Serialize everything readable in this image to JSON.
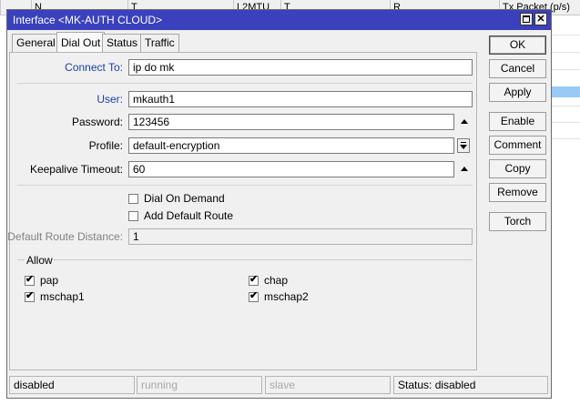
{
  "background": {
    "columns": [
      {
        "text": "N"
      },
      {
        "text": "T"
      },
      {
        "text": "L2MTU"
      },
      {
        "text": "T"
      },
      {
        "text": "R"
      },
      {
        "text": "Tx Packet (p/s)"
      }
    ]
  },
  "window": {
    "title": "Interface <MK-AUTH CLOUD>",
    "maximize_label": "",
    "close_label": "✕"
  },
  "tabs": [
    {
      "label": "General"
    },
    {
      "label": "Dial Out"
    },
    {
      "label": "Status"
    },
    {
      "label": "Traffic"
    }
  ],
  "form": {
    "connect_to": {
      "label": "Connect To:",
      "value": "ip do mk"
    },
    "user": {
      "label": "User:",
      "value": "mkauth1"
    },
    "password": {
      "label": "Password:",
      "value": "123456"
    },
    "profile": {
      "label": "Profile:",
      "value": "default-encryption"
    },
    "keepalive": {
      "label": "Keepalive Timeout:",
      "value": "60"
    },
    "dial_on_demand": {
      "label": "Dial On Demand",
      "checked": false
    },
    "add_default_route": {
      "label": "Add Default Route",
      "checked": false
    },
    "default_route_distance": {
      "label": "Default Route Distance:",
      "value": "1"
    }
  },
  "allow": {
    "legend": "Allow",
    "items": [
      {
        "label": "pap",
        "checked": true
      },
      {
        "label": "chap",
        "checked": true
      },
      {
        "label": "mschap1",
        "checked": true
      },
      {
        "label": "mschap2",
        "checked": true
      }
    ],
    "check_glyph": "✔"
  },
  "buttons": [
    {
      "label": "OK"
    },
    {
      "label": "Cancel"
    },
    {
      "label": "Apply"
    },
    {
      "label": "Enable"
    },
    {
      "label": "Comment"
    },
    {
      "label": "Copy"
    },
    {
      "label": "Remove"
    },
    {
      "label": "Torch"
    }
  ],
  "statusbar": [
    {
      "text": "disabled"
    },
    {
      "text": "running"
    },
    {
      "text": "slave"
    },
    {
      "text": "Status: disabled"
    }
  ]
}
